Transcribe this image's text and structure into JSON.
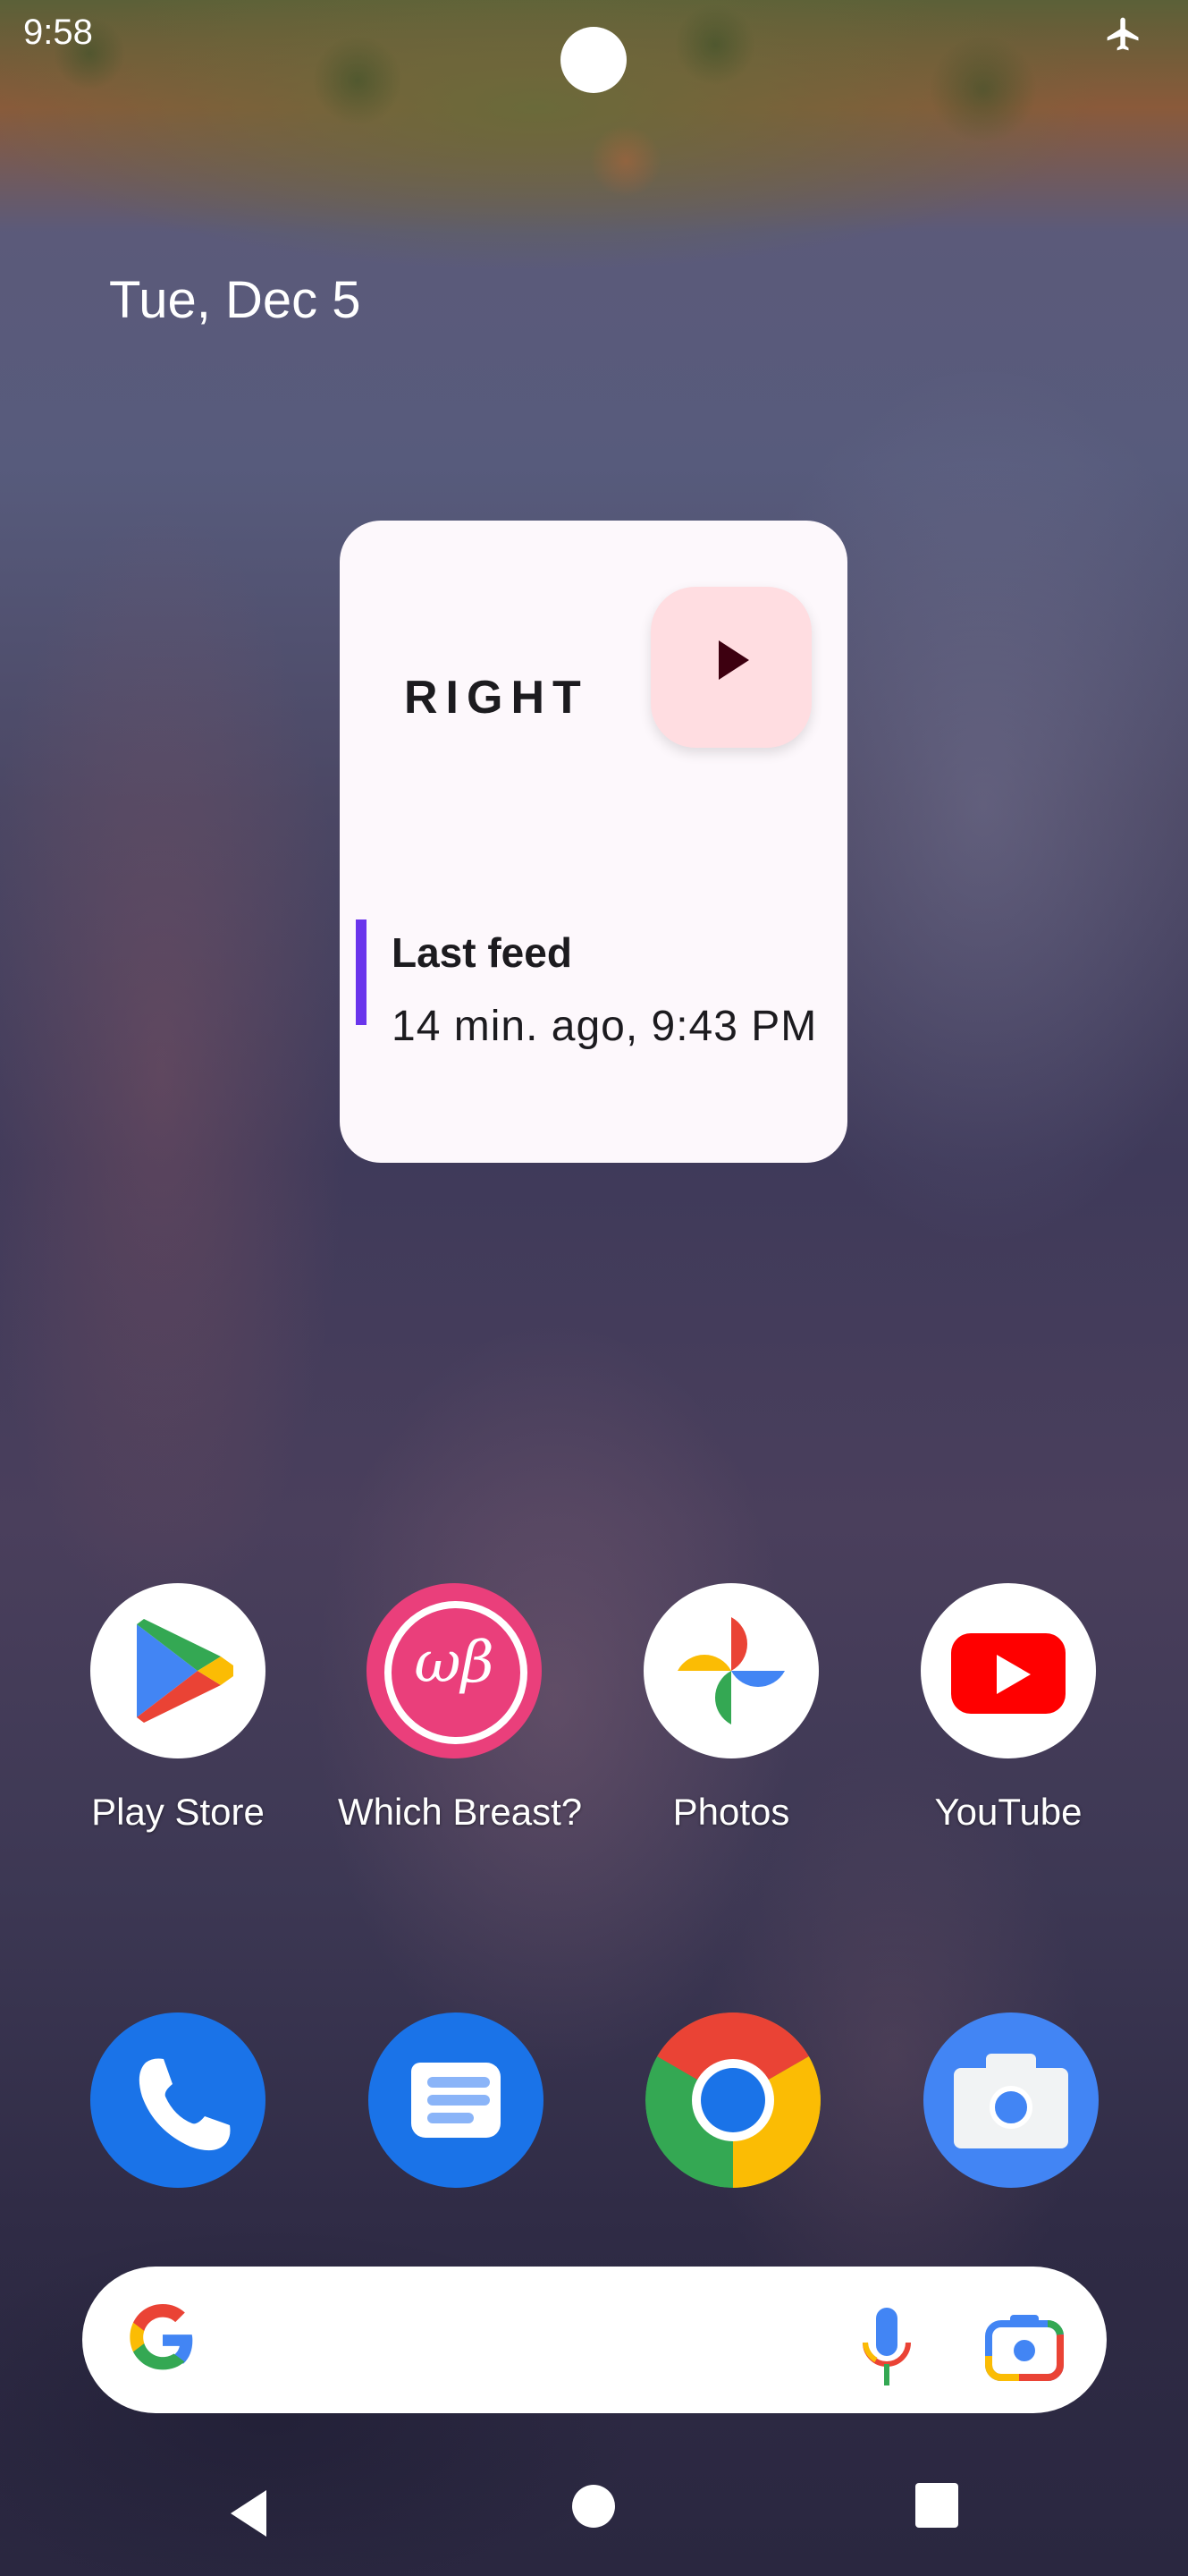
{
  "status_bar": {
    "time": "9:58",
    "icons": [
      "airplane-mode-icon"
    ]
  },
  "home": {
    "date": "Tue, Dec 5"
  },
  "widget": {
    "side_label": "RIGHT",
    "start_button_icon": "play-icon",
    "feed_title": "Last feed",
    "feed_time": "14 min. ago, 9:43 PM",
    "accent_color": "#6a35ec",
    "button_color": "#ffdde1"
  },
  "apps": [
    {
      "label": "Play Store",
      "icon": "play-store-icon"
    },
    {
      "label": "Which Breast?",
      "icon": "which-breast-icon",
      "glyph": "ωβ"
    },
    {
      "label": "Photos",
      "icon": "photos-icon"
    },
    {
      "label": "YouTube",
      "icon": "youtube-icon"
    }
  ],
  "dock": [
    {
      "name": "Phone",
      "icon": "phone-icon"
    },
    {
      "name": "Messages",
      "icon": "messages-icon"
    },
    {
      "name": "Chrome",
      "icon": "chrome-icon"
    },
    {
      "name": "Camera",
      "icon": "camera-icon"
    }
  ],
  "search": {
    "placeholder": "",
    "icons": [
      "google-logo-icon",
      "microphone-icon",
      "lens-icon"
    ]
  },
  "navigation": {
    "buttons": [
      "back",
      "home",
      "recents"
    ]
  }
}
